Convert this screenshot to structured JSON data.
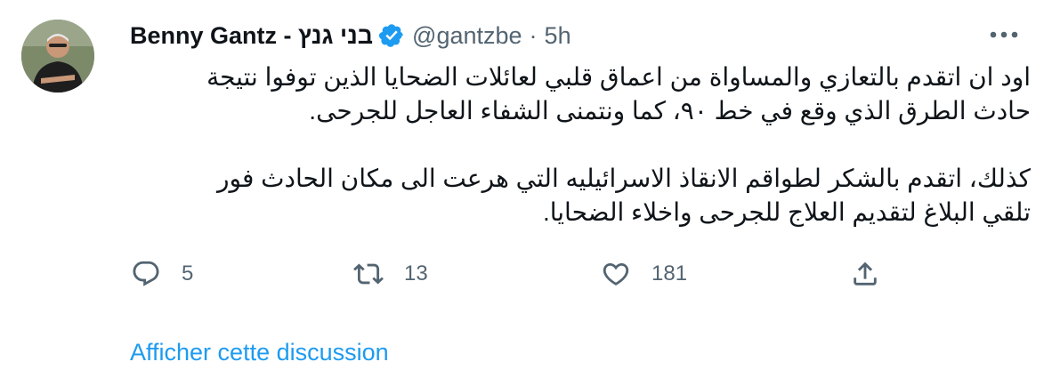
{
  "tweet": {
    "display_name": "Benny Gantz - בני גנץ",
    "handle": "@gantzbe",
    "separator": "·",
    "time": "5h",
    "paragraphs": [
      "اود ان اتقدم بالتعازي والمساواة من اعماق قلبي لعائلات الضحايا الذين توفوا نتيجة\nحادث الطرق الذي وقع في خط ٩٠، كما ونتمنى الشفاء العاجل للجرحى.",
      "كذلك، اتقدم بالشكر لطواقم الانقاذ الاسرائيليه التي هرعت الى مكان الحادث فور\nتلقي البلاغ لتقديم العلاج للجرحى واخلاء الضحايا."
    ]
  },
  "actions": {
    "reply_count": "5",
    "retweet_count": "13",
    "like_count": "181"
  },
  "icons": {
    "verified": "verified-badge-icon",
    "more": "more-icon",
    "reply": "reply-icon",
    "retweet": "retweet-icon",
    "like": "heart-icon",
    "share": "share-icon"
  },
  "colors": {
    "accent": "#1d9bf0",
    "text": "#0f1419",
    "secondary": "#536471"
  },
  "show_thread_label": "Afficher cette discussion"
}
